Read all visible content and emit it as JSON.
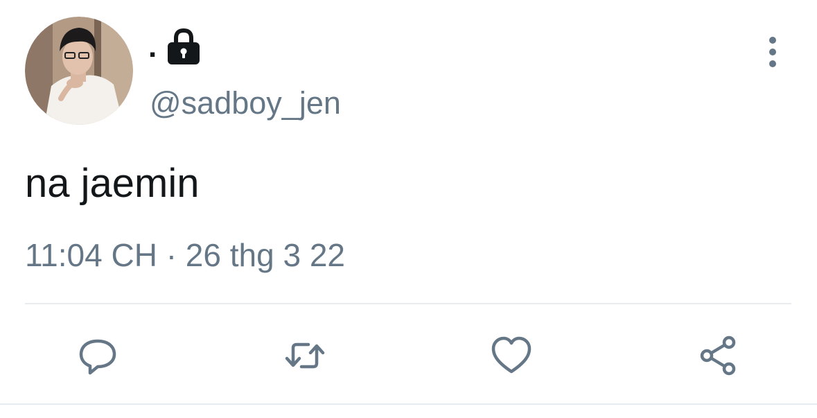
{
  "tweet": {
    "display_name": ".",
    "handle": "@sadboy_jen",
    "text": "na jaemin",
    "timestamp": "11:04 CH · 26 thg 3 22",
    "protected": true
  },
  "icons": {
    "lock": "lock-icon",
    "more": "more-vertical-icon",
    "reply": "reply-icon",
    "retweet": "retweet-icon",
    "like": "heart-icon",
    "share": "share-icon"
  },
  "colors": {
    "text_primary": "#14171a",
    "text_secondary": "#657786",
    "divider": "#e6ecf0"
  }
}
